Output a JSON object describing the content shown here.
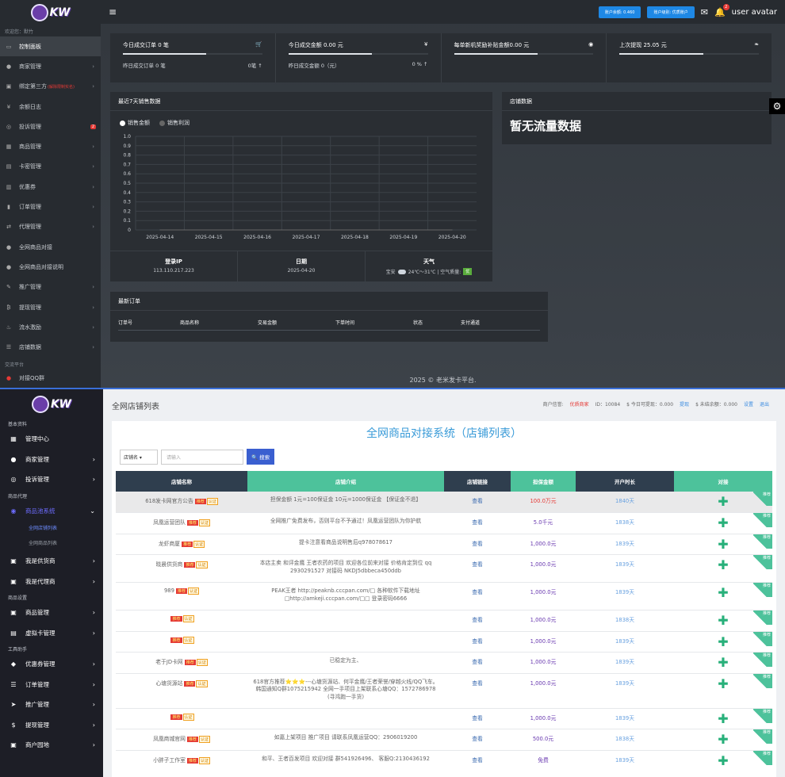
{
  "top": {
    "logo_text": "KW",
    "welcome": "欢迎您：默竹",
    "sidebar": [
      {
        "label": "控制面板",
        "icon": "monitor-icon"
      },
      {
        "label": "商家管理",
        "icon": "user-icon"
      },
      {
        "label": "绑定第三方",
        "icon": "link-icon",
        "extra": "(解除限制实名)"
      },
      {
        "label": "余额日志",
        "icon": "yen-icon"
      },
      {
        "label": "投诉管理",
        "icon": "alert-icon",
        "badge": "2"
      },
      {
        "label": "商品管理",
        "icon": "shop-icon"
      },
      {
        "label": "卡密管理",
        "icon": "card-icon"
      },
      {
        "label": "优惠券",
        "icon": "coupon-icon"
      },
      {
        "label": "订单管理",
        "icon": "chart-icon"
      },
      {
        "label": "代理管理",
        "icon": "swap-icon"
      },
      {
        "label": "全网商品对接",
        "icon": "circle-icon"
      },
      {
        "label": "全网商品对接说明",
        "icon": "circle-icon"
      },
      {
        "label": "推广管理",
        "icon": "edit-icon"
      },
      {
        "label": "提现管理",
        "icon": "bitcoin-icon"
      },
      {
        "label": "流水激励",
        "icon": "gift-icon"
      },
      {
        "label": "店铺数据",
        "icon": "database-icon"
      }
    ],
    "sidebar_section": "交流平台",
    "sidebar_last": "对接QQ群",
    "topbar": {
      "pill1": "账户余额: 0.460",
      "pill2": "账户级别: 优质账户",
      "notif_count": "2",
      "user": "user avatar"
    },
    "stats": [
      {
        "title": "今日成交订单 0 笔",
        "icon": "cart-icon",
        "sub_l": "昨日成交订单 0 笔",
        "sub_r": "0笔 ↑"
      },
      {
        "title": "今日成交金额 0.00 元",
        "icon": "yen-icon",
        "sub_l": "昨日成交金额 0（元）",
        "sub_r": "0 % ↑"
      },
      {
        "title": "每单新机奖励补贴金额0.00 元",
        "icon": "eye-icon",
        "sub_l": "",
        "sub_r": ""
      },
      {
        "title": "上次提现 25.05 元",
        "icon": "leaf-icon",
        "sub_l": "",
        "sub_r": ""
      }
    ],
    "chart_panel_title": "最近7天销售数据",
    "legend": [
      "销售金额",
      "销售利润"
    ],
    "shop_panel_title": "店铺数据",
    "shop_panel_text": "暂无流量数据",
    "info": {
      "ip_label": "登录IP",
      "ip": "113.110.217.223",
      "date_label": "日期",
      "date": "2025-04-20",
      "weather_label": "天气",
      "weather_city": "宝安",
      "weather_temp": "24℃～31℃ | 空气质量:",
      "weather_q": "优"
    },
    "orders_title": "最新订单",
    "order_cols": [
      "订单号",
      "商品名称",
      "交易金额",
      "下单时间",
      "状态",
      "支付通道"
    ],
    "footer": "2025 © 老米发卡平台."
  },
  "chart_data": {
    "type": "line",
    "title": "最近7天销售数据",
    "x": [
      "2025-04-14",
      "2025-04-15",
      "2025-04-16",
      "2025-04-17",
      "2025-04-18",
      "2025-04-19",
      "2025-04-20"
    ],
    "series": [
      {
        "name": "销售金额",
        "values": [
          0,
          0,
          0,
          0,
          0,
          0,
          0
        ]
      },
      {
        "name": "销售利润",
        "values": [
          0,
          0,
          0,
          0,
          0,
          0,
          0
        ]
      }
    ],
    "yticks": [
      "1.0",
      "0.9",
      "0.8",
      "0.7",
      "0.6",
      "0.5",
      "0.4",
      "0.3",
      "0.2",
      "0.1",
      "0"
    ],
    "ylim": [
      0,
      1.0
    ],
    "grid": true,
    "legend_position": "top-left"
  },
  "bottom": {
    "logo_text": "KW",
    "page_title": "全网店铺列表",
    "user_line": {
      "label": "商户信誉:",
      "value": "优质商家",
      "id": "ID：10084",
      "today": "$ 今日可提现：0.000",
      "withdraw": "提现",
      "pending": "$ 未结余额：0.000",
      "settings": "设置",
      "logout": "退出"
    },
    "sidebar": [
      {
        "type": "sec",
        "label": "基本资料"
      },
      {
        "type": "item",
        "label": "管理中心",
        "icon": "dashboard-icon"
      },
      {
        "type": "item",
        "label": "商家管理",
        "icon": "user-icon",
        "arrow": true
      },
      {
        "type": "item",
        "label": "投诉管理",
        "icon": "alert-icon",
        "arrow": true
      },
      {
        "type": "sec",
        "label": "商品代理"
      },
      {
        "type": "item",
        "label": "商品池系统",
        "icon": "eye-icon",
        "arrow": true,
        "open": true
      },
      {
        "type": "sub",
        "label": "全网店铺列表",
        "active": true
      },
      {
        "type": "sub",
        "label": "全网商品列表"
      },
      {
        "type": "item",
        "label": "我是供货商",
        "icon": "bag-icon",
        "arrow": true
      },
      {
        "type": "item",
        "label": "我是代理商",
        "icon": "bag-icon",
        "arrow": true
      },
      {
        "type": "sec",
        "label": "商品设置"
      },
      {
        "type": "item",
        "label": "商品管理",
        "icon": "bag-icon",
        "arrow": true
      },
      {
        "type": "item",
        "label": "虚拟卡管理",
        "icon": "card-icon",
        "arrow": true
      },
      {
        "type": "sec",
        "label": "工具助手"
      },
      {
        "type": "item",
        "label": "优惠券管理",
        "icon": "tag-icon",
        "arrow": true
      },
      {
        "type": "item",
        "label": "订单管理",
        "icon": "list-icon",
        "arrow": true
      },
      {
        "type": "item",
        "label": "推广管理",
        "icon": "send-icon",
        "arrow": true
      },
      {
        "type": "item",
        "label": "提现管理",
        "icon": "dollar-icon",
        "arrow": true
      },
      {
        "type": "item",
        "label": "商户园地",
        "icon": "bag-icon",
        "arrow": true
      }
    ],
    "heading": "全网商品对接系统（店铺列表）",
    "search": {
      "select": "店铺名",
      "placeholder": "请输入",
      "button": "搜索"
    },
    "columns": [
      "店铺名称",
      "店铺介绍",
      "店铺链接",
      "担保金额",
      "开户时长",
      "对接"
    ],
    "hot_label": "推荐",
    "verify_label": "认证",
    "rec_label": "推荐",
    "rows": [
      {
        "name": "618发卡网官方公告",
        "intro": "担保金额 1元=100保证金 10元=1000保证金 【保证金不退】",
        "link": "查看",
        "money": "100.0万元",
        "money_red": true,
        "days": "1840天",
        "first": true
      },
      {
        "name": "凤凰运营团队",
        "intro": "全网推广免费发布，否则平台不予通过！凤凰运营团队为你护航",
        "link": "查看",
        "money": "5.0千元",
        "days": "1838天"
      },
      {
        "name": "龙虾商厦",
        "intro": "提卡注意看商品说明售后q978078617",
        "link": "查看",
        "money": "1,000.0元",
        "days": "1839天"
      },
      {
        "name": "晓晨供货商",
        "intro": "本店主卖 和评金鹰 王者农药的项目 欢迎各位前来对接 价格肯定到位 qq 2930291527 对接码 NKDJ5dbbeca450ddb",
        "link": "查看",
        "money": "1,000.0元",
        "days": "1839天",
        "tall": true
      },
      {
        "name": "989",
        "intro": "PEAK王者 http://peaknb.cccpan.com/□ 各种软件下载地址 □http://amkeji.cccpan.com/□□ 登录密码6666",
        "link": "查看",
        "money": "1,000.0元",
        "days": "1839天",
        "tall": true
      },
      {
        "name": "",
        "intro": "",
        "link": "查看",
        "money": "1,000.0元",
        "days": "1838天"
      },
      {
        "name": "",
        "intro": "",
        "link": "查看",
        "money": "1,000.0元",
        "days": "1839天"
      },
      {
        "name": "老于JD卡网",
        "intro": "已稳定为主、",
        "link": "查看",
        "money": "1,000.0元",
        "days": "1839天"
      },
      {
        "name": "心塘货源站",
        "intro": "618官方推荐⭐⭐⭐---心塘货源站、何平金鹰/王者荣誉/穿越火线/QQ飞车。韩国通知Q群1075215942 全网一手项目上架联系心塘QQ：1572786978 (寻鸿跑一手货)",
        "link": "查看",
        "money": "1,000.0元",
        "days": "1839天",
        "tall": true,
        "xtall": true
      },
      {
        "name": "",
        "intro": "",
        "link": "查看",
        "money": "1,000.0元",
        "days": "1839天"
      },
      {
        "name": "凤凰商城官网",
        "intro": "如嘉上架项目 推广项目 请联系凤凰运营QQ：2906019200",
        "link": "查看",
        "money": "500.0元",
        "days": "1838天"
      },
      {
        "name": "小胖子工作室",
        "intro": "和平、王者百发项目 欢迎对接 群541926496、 客服Q:2130436192",
        "link": "查看",
        "money": "免费",
        "days": "1839天",
        "tall": true
      }
    ]
  }
}
